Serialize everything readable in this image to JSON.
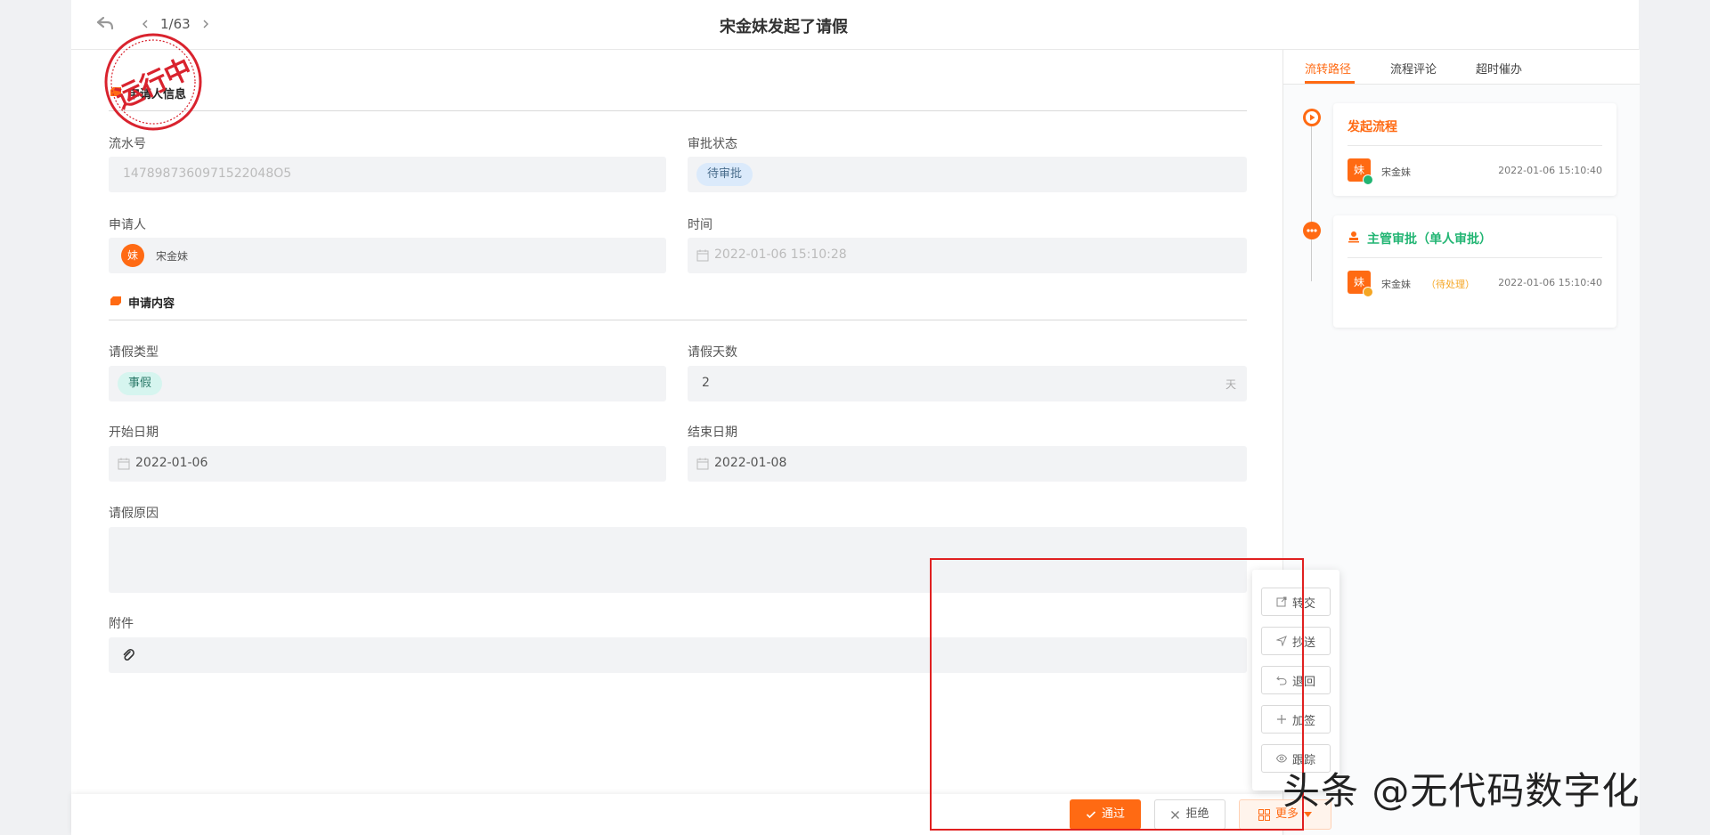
{
  "header": {
    "pager": "1/63",
    "title": "宋金妹发起了请假"
  },
  "stamp": {
    "text": "运行中"
  },
  "sections": {
    "applicant_info": "申请人信息",
    "request_content": "申请内容"
  },
  "form": {
    "serial_label": "流水号",
    "serial_value": "1478987360971522048O5",
    "status_label": "审批状态",
    "status_value": "待审批",
    "applicant_label": "申请人",
    "applicant_avatar": "妹",
    "applicant_name": "宋金妹",
    "time_label": "时间",
    "time_value": "2022-01-06 15:10:28",
    "leave_type_label": "请假类型",
    "leave_type_value": "事假",
    "leave_days_label": "请假天数",
    "leave_days_value": "2",
    "leave_days_unit": "天",
    "start_label": "开始日期",
    "start_value": "2022-01-06",
    "end_label": "结束日期",
    "end_value": "2022-01-08",
    "reason_label": "请假原因",
    "reason_value": "",
    "attachment_label": "附件"
  },
  "side": {
    "tabs": [
      "流转路径",
      "流程评论",
      "超时催办"
    ],
    "steps": [
      {
        "title": "发起流程",
        "avatar": "妹",
        "user": "宋金妹",
        "status": "",
        "time": "2022-01-06 15:10:40"
      },
      {
        "title": "主管审批（单人审批）",
        "avatar": "妹",
        "user": "宋金妹",
        "status": "（待处理）",
        "time": "2022-01-06 15:10:40"
      }
    ]
  },
  "actions": {
    "pass": "通过",
    "reject": "拒绝",
    "more": "更多",
    "more_menu": [
      "转交",
      "抄送",
      "退回",
      "加签",
      "跟踪"
    ]
  },
  "watermark": "头条 @无代码数字化",
  "colors": {
    "accent": "#ff6a13",
    "green": "#22b573",
    "pending": "#f5a623",
    "highlight": "#e02020"
  }
}
